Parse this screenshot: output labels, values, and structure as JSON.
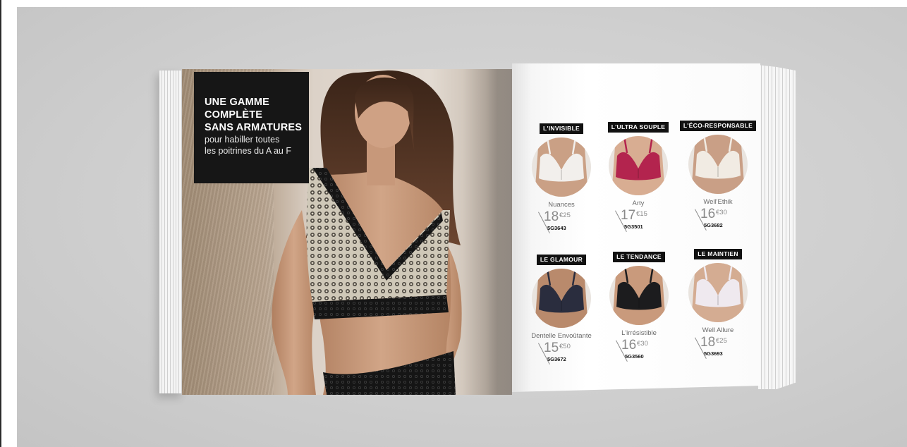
{
  "promo": {
    "title_lines": [
      "UNE GAMME",
      "COMPLÈTE",
      "SANS ARMATURES"
    ],
    "subtitle_lines": [
      "pour habiller toutes",
      "les poitrines du A au F"
    ]
  },
  "products": [
    {
      "tag": "L'INVISIBLE",
      "name": "Nuances",
      "price_int": "18",
      "price_cents": "€25",
      "ref": "5G3643",
      "color": "#f2efec",
      "skin": "#caa085"
    },
    {
      "tag": "L'ULTRA SOUPLE",
      "name": "Arty",
      "price_int": "17",
      "price_cents": "€15",
      "ref": "5G3501",
      "color": "#b3244e",
      "skin": "#d8ad92"
    },
    {
      "tag": "L'ÉCO-RESPONSABLE",
      "name": "Well'Ethik",
      "price_int": "16",
      "price_cents": "€30",
      "ref": "5G3682",
      "color": "#f1ebe3",
      "skin": "#c99f86"
    },
    {
      "tag": "LE GLAMOUR",
      "name": "Dentelle Envoûtante",
      "price_int": "15",
      "price_cents": "€50",
      "ref": "5G3672",
      "color": "#2a2d3e",
      "skin": "#b98a6c"
    },
    {
      "tag": "LE TENDANCE",
      "name": "L'irrésistible",
      "price_int": "16",
      "price_cents": "€30",
      "ref": "5G3560",
      "color": "#1c1c1e",
      "skin": "#c99a7c"
    },
    {
      "tag": "LE MAINTIEN",
      "name": "Well Allure",
      "price_int": "18",
      "price_cents": "€25",
      "ref": "5G3693",
      "color": "#efe9ef",
      "skin": "#d4ac92"
    }
  ]
}
